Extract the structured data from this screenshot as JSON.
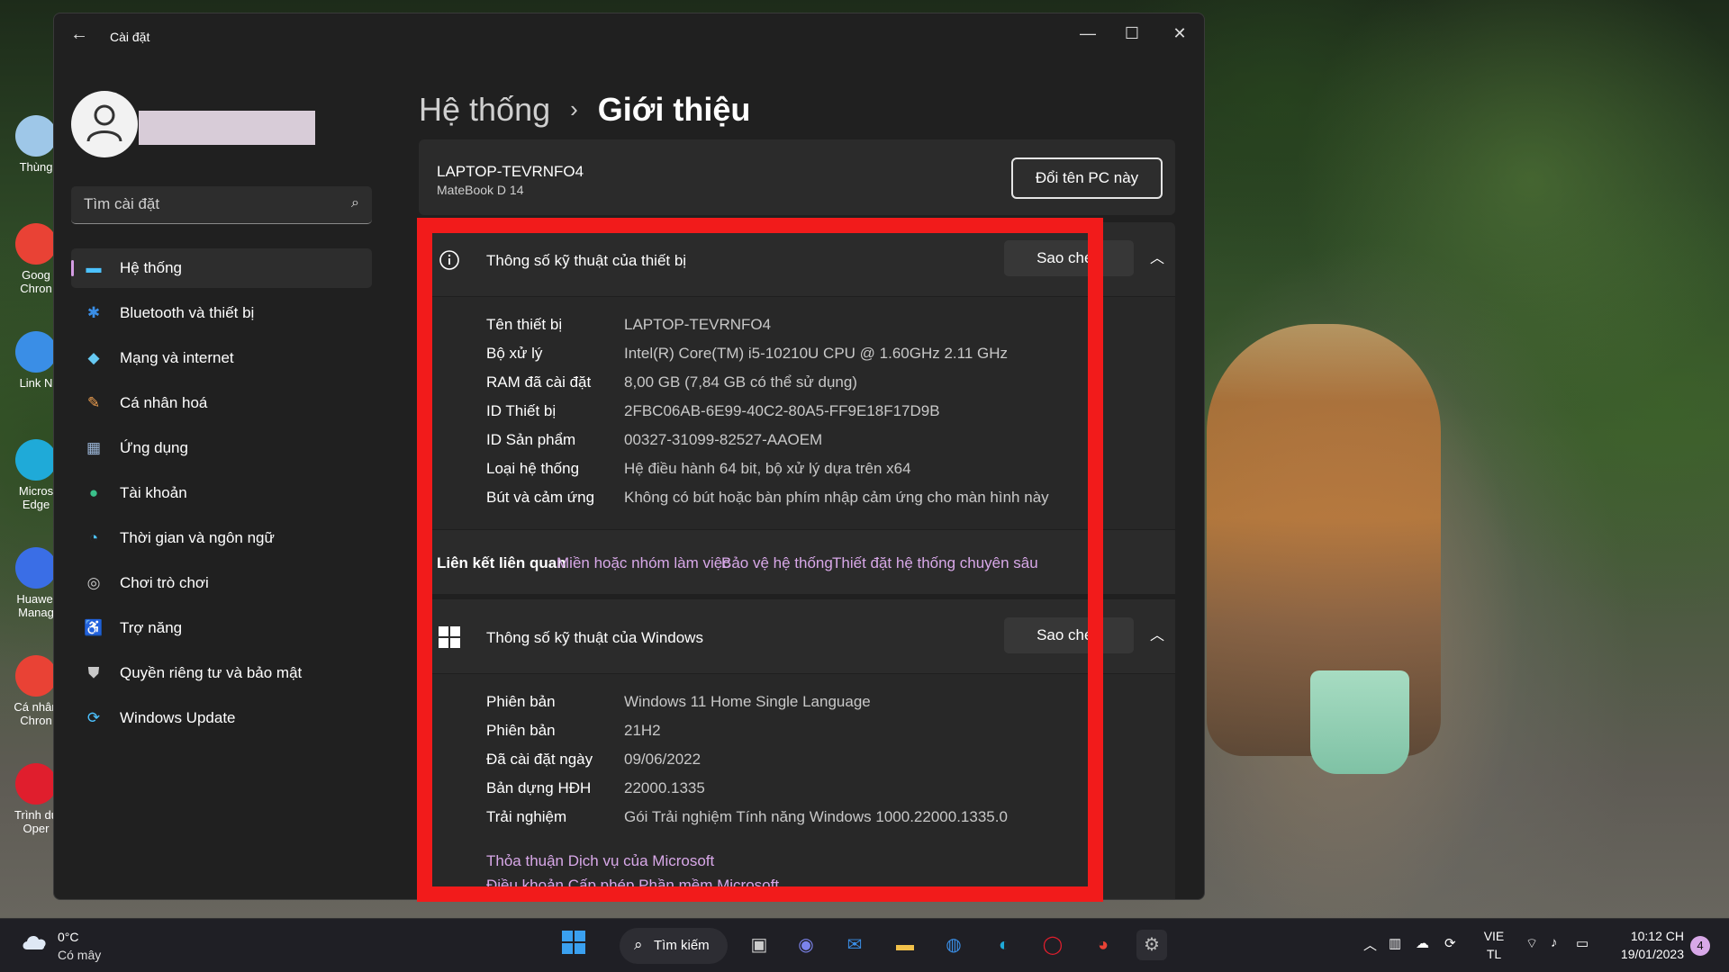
{
  "desktop": {
    "icons": [
      {
        "label": "Thùng",
        "color": "#9ec7e8"
      },
      {
        "label": "Goog Chron",
        "color": "#e94235"
      },
      {
        "label": "Link N",
        "color": "#3a8ee6"
      },
      {
        "label": "Micros Edge",
        "color": "#1faad8"
      },
      {
        "label": "Huawei Manag",
        "color": "#3a6ee6"
      },
      {
        "label": "Cá nhân Chron",
        "color": "#e94235"
      },
      {
        "label": "Trình du Oper",
        "color": "#e01e2d"
      }
    ]
  },
  "window": {
    "title": "Cài đặt",
    "back_icon": "←",
    "minimize_icon": "—",
    "maximize_icon": "☐",
    "close_icon": "✕"
  },
  "sidebar": {
    "search_placeholder": "Tìm cài đặt",
    "search_icon": "⌕",
    "items": [
      {
        "label": "Hệ thống",
        "icon": "▬",
        "color": "#4cc2ff",
        "active": true
      },
      {
        "label": "Bluetooth và thiết bị",
        "icon": "✱",
        "color": "#3a8ee6"
      },
      {
        "label": "Mạng và internet",
        "icon": "◆",
        "color": "#66c9f2"
      },
      {
        "label": "Cá nhân hoá",
        "icon": "✎",
        "color": "#f0a050"
      },
      {
        "label": "Ứng dụng",
        "icon": "▦",
        "color": "#9ab5d6"
      },
      {
        "label": "Tài khoản",
        "icon": "●",
        "color": "#3ac08a"
      },
      {
        "label": "Thời gian và ngôn ngữ",
        "icon": "◔",
        "color": "#4cc2ff"
      },
      {
        "label": "Chơi trò chơi",
        "icon": "◎",
        "color": "#c8c8c8"
      },
      {
        "label": "Trợ năng",
        "icon": "♿",
        "color": "#4cc2ff"
      },
      {
        "label": "Quyền riêng tư và bảo mật",
        "icon": "⛊",
        "color": "#c8c8c8"
      },
      {
        "label": "Windows Update",
        "icon": "⟳",
        "color": "#4cc2ff"
      }
    ]
  },
  "main": {
    "breadcrumb_parent": "Hệ thống",
    "breadcrumb_sep": "›",
    "breadcrumb_current": "Giới thiệu",
    "pc_name": "LAPTOP-TEVRNFO4",
    "pc_model": "MateBook D 14",
    "rename_button": "Đổi tên PC này",
    "device_specs": {
      "title": "Thông số kỹ thuật của thiết bị",
      "copy_button": "Sao chép",
      "rows": [
        {
          "key": "Tên thiết bị",
          "value": "LAPTOP-TEVRNFO4"
        },
        {
          "key": "Bộ xử lý",
          "value": "Intel(R) Core(TM) i5-10210U CPU @ 1.60GHz   2.11 GHz"
        },
        {
          "key": "RAM đã cài đặt",
          "value": "8,00 GB (7,84 GB có thể sử dụng)"
        },
        {
          "key": "ID Thiết bị",
          "value": "2FBC06AB-6E99-40C2-80A5-FF9E18F17D9B"
        },
        {
          "key": "ID Sản phẩm",
          "value": "00327-31099-82527-AAOEM"
        },
        {
          "key": "Loại hệ thống",
          "value": "Hệ điều hành 64 bit, bộ xử lý dựa trên x64"
        },
        {
          "key": "Bút và cảm ứng",
          "value": "Không có bút hoặc bàn phím nhập cảm ứng cho màn hình này"
        }
      ]
    },
    "related": {
      "label": "Liên kết liên quan",
      "links": [
        "Miền hoặc nhóm làm việc",
        "Bảo vệ hệ thống",
        "Thiết đặt hệ thống chuyên sâu"
      ]
    },
    "windows_specs": {
      "title": "Thông số kỹ thuật của Windows",
      "copy_button": "Sao chép",
      "rows": [
        {
          "key": "Phiên bản",
          "value": "Windows 11 Home Single Language"
        },
        {
          "key": "Phiên bản",
          "value": "21H2"
        },
        {
          "key": "Đã cài đặt ngày",
          "value": "09/06/2022"
        },
        {
          "key": "Bản dựng HĐH",
          "value": "22000.1335"
        },
        {
          "key": "Trải nghiệm",
          "value": "Gói Trải nghiệm Tính năng Windows 1000.22000.1335.0"
        }
      ],
      "links": [
        "Thỏa thuận Dịch vụ của Microsoft",
        "Điều khoản Cấp phép Phần mềm Microsoft"
      ]
    }
  },
  "taskbar": {
    "weather_temp": "0°C",
    "weather_cond": "Có mây",
    "search_label": "Tìm kiếm",
    "lang_top": "VIE",
    "lang_bottom": "TL",
    "time": "10:12 CH",
    "date": "19/01/2023",
    "notification_count": "4"
  }
}
